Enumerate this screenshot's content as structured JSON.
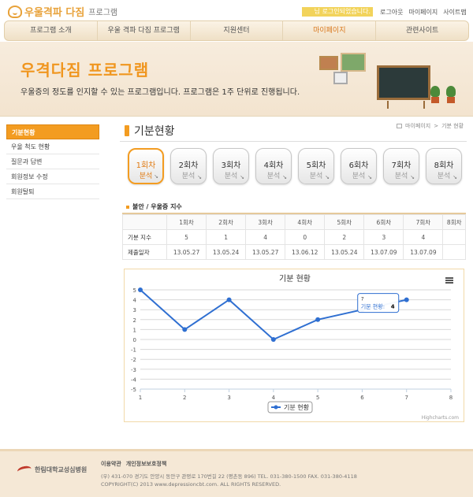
{
  "header": {
    "logo_text": "우울격파 다짐",
    "logo_sub": "프로그램",
    "user_message": "님 로그인되었습니다.",
    "links": [
      "로그아웃",
      "마이페이지",
      "사이트맵"
    ]
  },
  "nav": {
    "items": [
      {
        "label": "프로그램 소개"
      },
      {
        "label": "우울 격파 다짐 프로그램"
      },
      {
        "label": "지원센터"
      },
      {
        "label": "마이페이지"
      },
      {
        "label": "관련사이트"
      }
    ]
  },
  "banner": {
    "title": "우격다짐 프로그램",
    "description": "우울증의 정도를 인지할 수 있는 프로그램입니다. 프로그램은 1주 단위로 진행됩니다."
  },
  "sidebar": {
    "items": [
      {
        "label": "기분현황"
      },
      {
        "label": "우울 척도 현황"
      },
      {
        "label": "질문과 답변"
      },
      {
        "label": "회원정보 수정"
      },
      {
        "label": "회원탈퇴"
      }
    ]
  },
  "page": {
    "title": "기분현황",
    "breadcrumb": [
      "마이페이지",
      ">",
      "기분 현황"
    ]
  },
  "sessions": [
    {
      "num": "1회차",
      "label": "분석"
    },
    {
      "num": "2회차",
      "label": "분석"
    },
    {
      "num": "3회차",
      "label": "분석"
    },
    {
      "num": "4회차",
      "label": "분석"
    },
    {
      "num": "5회차",
      "label": "분석"
    },
    {
      "num": "6회차",
      "label": "분석"
    },
    {
      "num": "7회차",
      "label": "분석"
    },
    {
      "num": "8회차",
      "label": "분석"
    }
  ],
  "section": {
    "title": "불안 / 우울증 지수"
  },
  "table": {
    "headers": [
      "",
      "1회차",
      "2회차",
      "3회차",
      "4회차",
      "5회차",
      "6회차",
      "7회차",
      "8회차"
    ],
    "rows": [
      {
        "label": "기분 지수",
        "cells": [
          "5",
          "1",
          "4",
          "0",
          "2",
          "3",
          "4",
          ""
        ]
      },
      {
        "label": "제출일자",
        "cells": [
          "13.05.27",
          "13.05.24",
          "13.05.27",
          "13.06.12",
          "13.05.24",
          "13.07.09",
          "13.07.09",
          ""
        ]
      }
    ]
  },
  "chart_data": {
    "type": "line",
    "title": "기분 현황",
    "x": [
      1,
      2,
      3,
      4,
      5,
      6,
      7
    ],
    "series": [
      {
        "name": "기분 현황",
        "values": [
          5,
          1,
          4,
          0,
          2,
          3,
          4
        ],
        "color": "#2f6fd1"
      }
    ],
    "xlim": [
      1,
      8
    ],
    "ylim": [
      -5,
      5
    ],
    "xticks": [
      1,
      2,
      3,
      4,
      5,
      6,
      7,
      8
    ],
    "yticks": [
      -5,
      -4,
      -3,
      -2,
      -1,
      0,
      1,
      2,
      3,
      4,
      5
    ],
    "grid": true,
    "legend": "bottom-center",
    "tooltip": {
      "x_label": "7",
      "series_label": "기분 현황:",
      "value": "4"
    },
    "credit": "Highcharts.com"
  },
  "footer": {
    "logo_text": "한림대학교성심병원",
    "links": [
      "이용약관",
      "개인정보보호정책"
    ],
    "address": "(우) 431-070 경기도 안양시 동안구 관평로 170번길 22 (평촌동 896) TEL. 031-380-1500   FAX. 031-380-4118",
    "copyright": "COPYRIGHT(C) 2013  www.depressioncbt.com. ALL RIGHTS RESERVED."
  }
}
